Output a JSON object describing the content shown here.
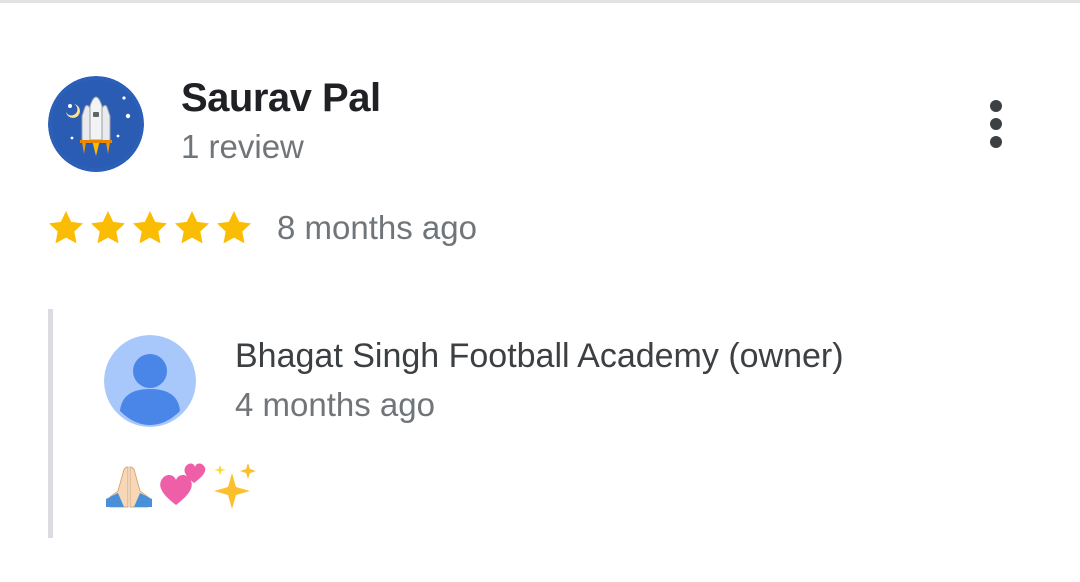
{
  "review": {
    "reviewer_name": "Saurav Pal",
    "review_count": "1 review",
    "rating": 5,
    "rating_max": 5,
    "date": "8 months ago",
    "avatar_icon": "rocket-shuttle-avatar"
  },
  "more_menu": {
    "icon": "more-vert-icon"
  },
  "owner_reply": {
    "owner_name": "Bhagat Singh Football Academy (owner)",
    "date": "4 months ago",
    "avatar_icon": "default-person-avatar",
    "emojis": [
      "folded-hands-emoji",
      "two-hearts-emoji",
      "sparkles-emoji"
    ]
  },
  "colors": {
    "star": "#fbbc04",
    "name_text": "#202124",
    "secondary_text": "#70757a",
    "owner_text": "#3c4043",
    "reply_bar": "#dadce0",
    "avatar_bg": "#2b5fb8",
    "owner_avatar_bg": "#a8c7fa",
    "owner_avatar_fg": "#4a86e8"
  }
}
